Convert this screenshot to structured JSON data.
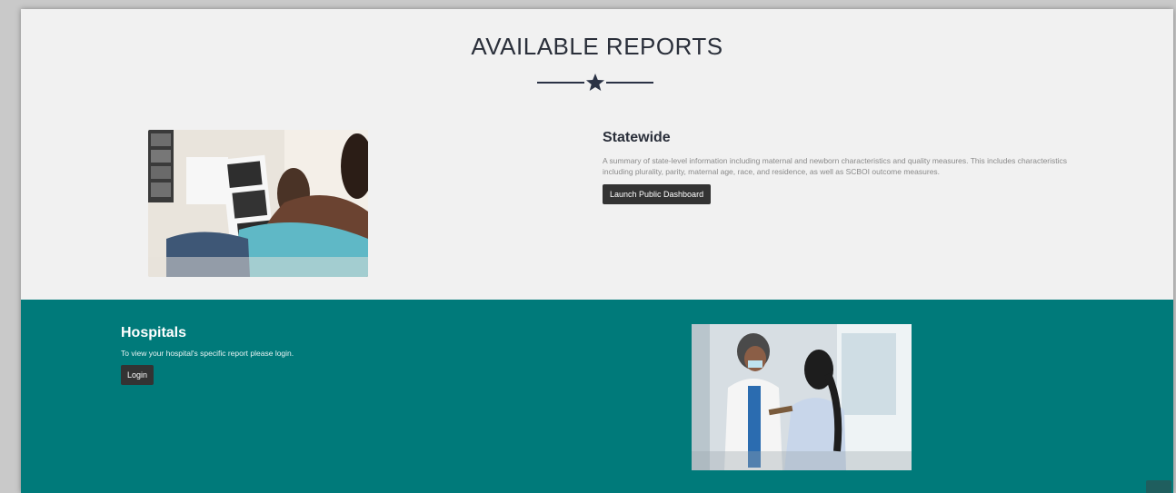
{
  "page": {
    "heading": "AVAILABLE REPORTS"
  },
  "statewide": {
    "title": "Statewide",
    "description": "A summary of state-level information including maternal and newborn characteristics and quality measures. This includes characteristics including plurality, parity, maternal age, race, and residence, as well as SCBOI outcome measures.",
    "button_label": "Launch Public Dashboard",
    "image_icon": "pregnant-woman-ultrasound-photo"
  },
  "hospitals": {
    "title": "Hospitals",
    "description": "To view your hospital's specific report please login.",
    "button_label": "Login",
    "image_icon": "doctor-patient-consultation-photo"
  },
  "colors": {
    "background": "#f1f1f1",
    "teal": "#007a7a",
    "heading": "#2a2f3a",
    "button": "#333333"
  }
}
